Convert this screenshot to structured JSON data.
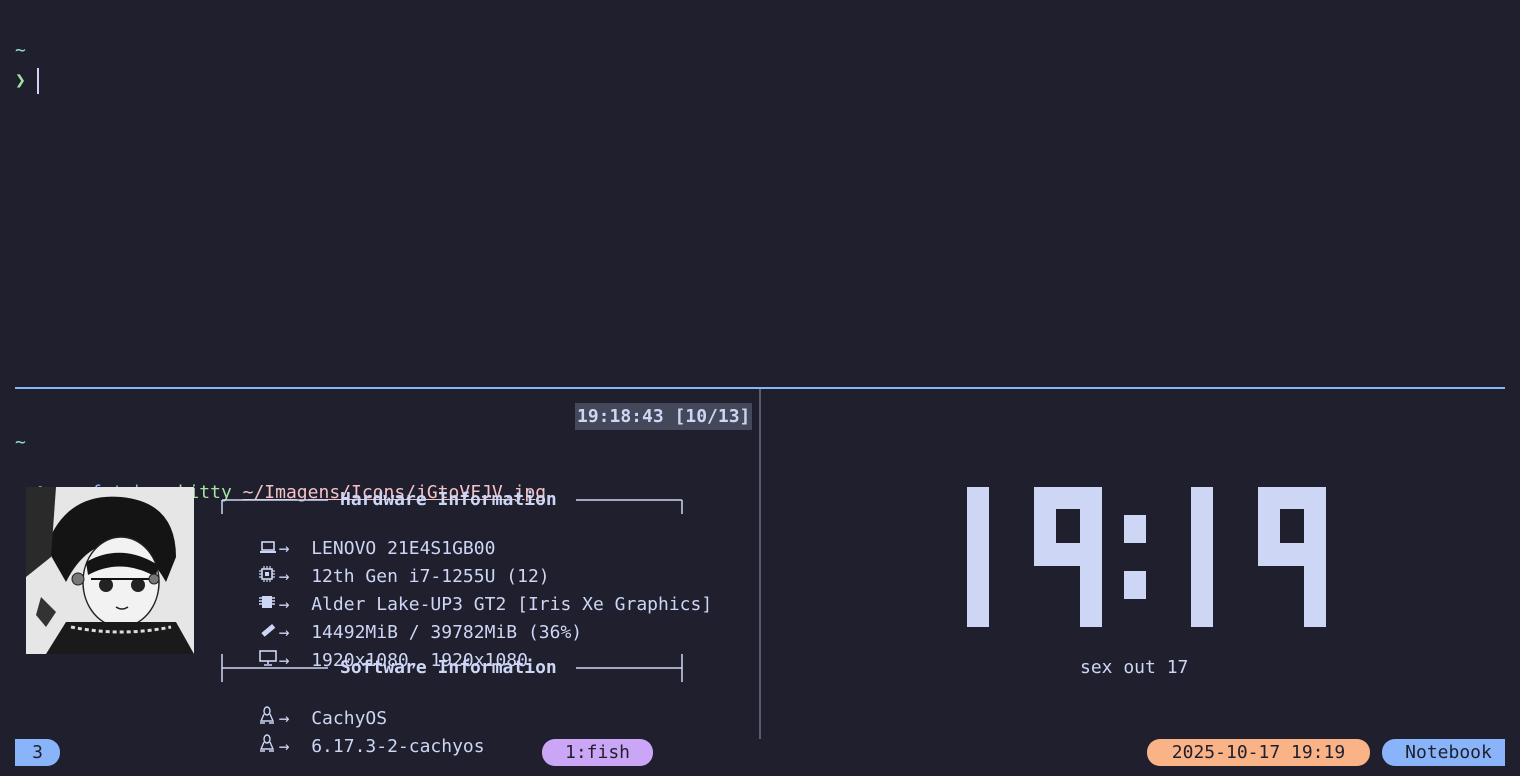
{
  "top_pane": {
    "tilde": "~",
    "prompt": "❯"
  },
  "bottom_left_pane": {
    "time_badge": "19:18:43 [10/13]",
    "tilde": "~",
    "prompt": "❯",
    "command": "neofetch",
    "flag": "--kitty",
    "path": "~/Imagens/Icons/jGtoVFJV.jpg",
    "hardware_title": "Hardware Information",
    "software_title": "Software Information",
    "arrow": "→",
    "hardware": [
      {
        "icon": "laptop-icon",
        "glyph": "💻",
        "value": "LENOVO 21E4S1GB00"
      },
      {
        "icon": "cpu-icon",
        "glyph": "⚙",
        "value": "12th Gen i7-1255U (12)"
      },
      {
        "icon": "gpu-icon",
        "glyph": "▦",
        "value": "Alder Lake-UP3 GT2 [Iris Xe Graphics]"
      },
      {
        "icon": "memory-icon",
        "glyph": "▬",
        "value": "14492MiB / 39782MiB (36%)"
      },
      {
        "icon": "monitor-icon",
        "glyph": "▭",
        "value": "1920x1080, 1920x1080"
      }
    ],
    "software": [
      {
        "icon": "linux-icon",
        "glyph": "🐧",
        "value": "CachyOS"
      },
      {
        "icon": "linux-icon",
        "glyph": "🐧",
        "value": "6.17.3-2-cachyos"
      }
    ]
  },
  "clock_pane": {
    "time": "19:19",
    "date": "sex out 17"
  },
  "status_bar": {
    "workspace": "3",
    "window": "1:fish",
    "datetime": "2025-10-17 19:19",
    "host": "Notebook",
    "colors": {
      "workspace": "#89b4fa",
      "window": "#cba6f7",
      "datetime": "#fab387",
      "host": "#89b4fa"
    }
  }
}
